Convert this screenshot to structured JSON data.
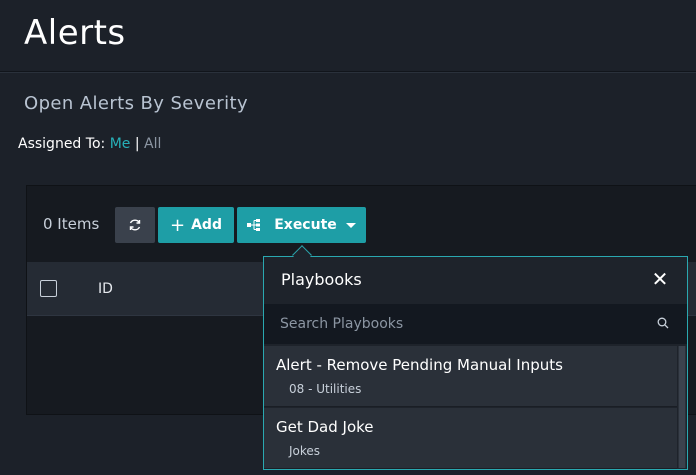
{
  "header": {
    "title": "Alerts"
  },
  "section": {
    "title": "Open Alerts By Severity",
    "assigned_label": "Assigned To:",
    "assigned_me": "Me",
    "assigned_sep": "|",
    "assigned_all": "All"
  },
  "toolbar": {
    "items_count": "0 Items",
    "refresh_icon": "refresh-icon",
    "add_label": "Add",
    "execute_label": "Execute"
  },
  "table": {
    "columns": [
      "ID"
    ]
  },
  "playbooks": {
    "title": "Playbooks",
    "search_placeholder": "Search Playbooks",
    "items": [
      {
        "name": "Alert - Remove Pending Manual Inputs",
        "category": "08 - Utilities"
      },
      {
        "name": "Get Dad Joke",
        "category": "Jokes"
      }
    ]
  },
  "colors": {
    "accent": "#1e9ea6",
    "background": "#1c2129",
    "link": "#27b0b8"
  }
}
